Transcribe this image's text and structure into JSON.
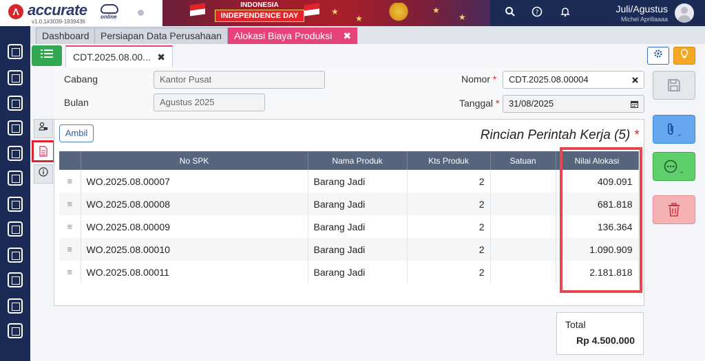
{
  "header": {
    "brand": "accurate",
    "brand_suffix": "online",
    "version": "v1.0.1#3039-1939436",
    "banner_line1": "INDONESIA",
    "banner_line2": "INDEPENDENCE DAY",
    "period": "Juli/Agustus",
    "user": "Michel Aprillaaaa"
  },
  "tabs": {
    "items": [
      {
        "label": "Dashboard"
      },
      {
        "label": "Persiapan Data Perusahaan"
      },
      {
        "label": "Alokasi Biaya Produksi"
      }
    ],
    "close_symbol": "✖",
    "count": "3"
  },
  "doc_tab": {
    "label": "CDT.2025.08.00...",
    "close_symbol": "✖"
  },
  "form": {
    "cabang_label": "Cabang",
    "cabang_value": "Kantor Pusat",
    "bulan_label": "Bulan",
    "bulan_value": "Agustus 2025",
    "nomor_label": "Nomor",
    "nomor_value": "CDT.2025.08.00004",
    "tanggal_label": "Tanggal",
    "tanggal_value": "31/08/2025",
    "required_mark": "*"
  },
  "detail": {
    "ambil_label": "Ambil",
    "title": "Rincian Perintah Kerja (5)",
    "columns": [
      "",
      "No SPK",
      "Nama Produk",
      "Kts Produk",
      "Satuan",
      "Nilai Alokasi"
    ],
    "rows": [
      {
        "no_spk": "WO.2025.08.00007",
        "nama_produk": "Barang Jadi",
        "kts": "2",
        "satuan": "",
        "nilai": "409.091"
      },
      {
        "no_spk": "WO.2025.08.00008",
        "nama_produk": "Barang Jadi",
        "kts": "2",
        "satuan": "",
        "nilai": "681.818"
      },
      {
        "no_spk": "WO.2025.08.00009",
        "nama_produk": "Barang Jadi",
        "kts": "2",
        "satuan": "",
        "nilai": "136.364"
      },
      {
        "no_spk": "WO.2025.08.00010",
        "nama_produk": "Barang Jadi",
        "kts": "2",
        "satuan": "",
        "nilai": "1.090.909"
      },
      {
        "no_spk": "WO.2025.08.00011",
        "nama_produk": "Barang Jadi",
        "kts": "2",
        "satuan": "",
        "nilai": "2.181.818"
      }
    ]
  },
  "total": {
    "label": "Total",
    "value": "Rp 4.500.000"
  },
  "icons": {
    "search": "search-icon",
    "help": "help-icon",
    "bell": "bell-icon",
    "gear": "gear-icon",
    "lightbulb": "lightbulb-icon",
    "save": "save-icon",
    "paperclip": "paperclip-icon",
    "more": "more-icon",
    "trash": "trash-icon",
    "calendar": "calendar-icon"
  },
  "colors": {
    "navy": "#1b2b56",
    "active_tab": "#e5437a",
    "highlight": "#e8464f",
    "green": "#33a852"
  }
}
